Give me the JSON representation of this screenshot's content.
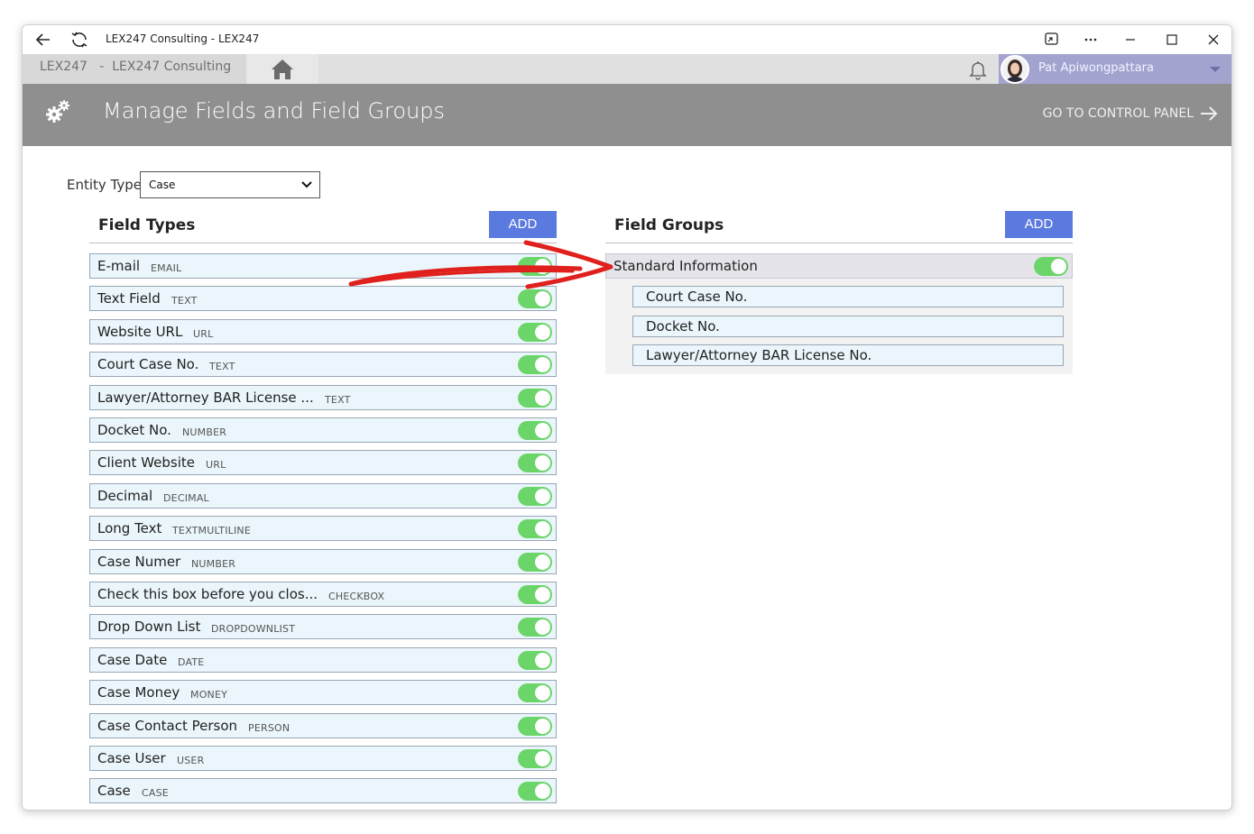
{
  "window": {
    "title": "LEX247 Consulting - LEX247"
  },
  "nav": {
    "tab_label": "LEX247   -  LEX247 Consulting",
    "user_name": "Pat Apiwongpattara"
  },
  "header": {
    "title": "Manage Fields and Field Groups",
    "control_panel": "GO TO CONTROL PANEL"
  },
  "entity": {
    "label": "Entity Type",
    "selected": "Case"
  },
  "field_types": {
    "title": "Field Types",
    "add_label": "ADD",
    "items": [
      {
        "name": "E-mail",
        "type": "EMAIL",
        "enabled": true
      },
      {
        "name": "Text Field",
        "type": "TEXT",
        "enabled": true
      },
      {
        "name": "Website URL",
        "type": "URL",
        "enabled": true
      },
      {
        "name": "Court Case No.",
        "type": "TEXT",
        "enabled": true
      },
      {
        "name": "Lawyer/Attorney BAR License ...",
        "type": "TEXT",
        "enabled": true
      },
      {
        "name": "Docket No.",
        "type": "NUMBER",
        "enabled": true
      },
      {
        "name": "Client Website",
        "type": "URL",
        "enabled": true
      },
      {
        "name": "Decimal",
        "type": "DECIMAL",
        "enabled": true
      },
      {
        "name": "Long Text",
        "type": "TEXTMULTILINE",
        "enabled": true
      },
      {
        "name": "Case Numer",
        "type": "NUMBER",
        "enabled": true
      },
      {
        "name": "Check this box before you clos...",
        "type": "CHECKBOX",
        "enabled": true
      },
      {
        "name": "Drop Down List",
        "type": "DROPDOWNLIST",
        "enabled": true
      },
      {
        "name": "Case Date",
        "type": "DATE",
        "enabled": true
      },
      {
        "name": "Case Money",
        "type": "MONEY",
        "enabled": true
      },
      {
        "name": "Case Contact Person",
        "type": "PERSON",
        "enabled": true
      },
      {
        "name": "Case User",
        "type": "USER",
        "enabled": true
      },
      {
        "name": "Case",
        "type": "CASE",
        "enabled": true
      }
    ]
  },
  "field_groups": {
    "title": "Field Groups",
    "add_label": "ADD",
    "groups": [
      {
        "name": "Standard Information",
        "enabled": true,
        "fields": [
          "Court Case No.",
          "Docket No.",
          "Lawyer/Attorney BAR License No."
        ]
      }
    ]
  },
  "colors": {
    "header_bg": "#8f8f8f",
    "add_button": "#5b7ae0",
    "toggle_on": "#6cd56a",
    "row_bg": "#eaf6fb",
    "user_bar": "#a2a4cf",
    "annotation_arrow": "#e0201c"
  }
}
